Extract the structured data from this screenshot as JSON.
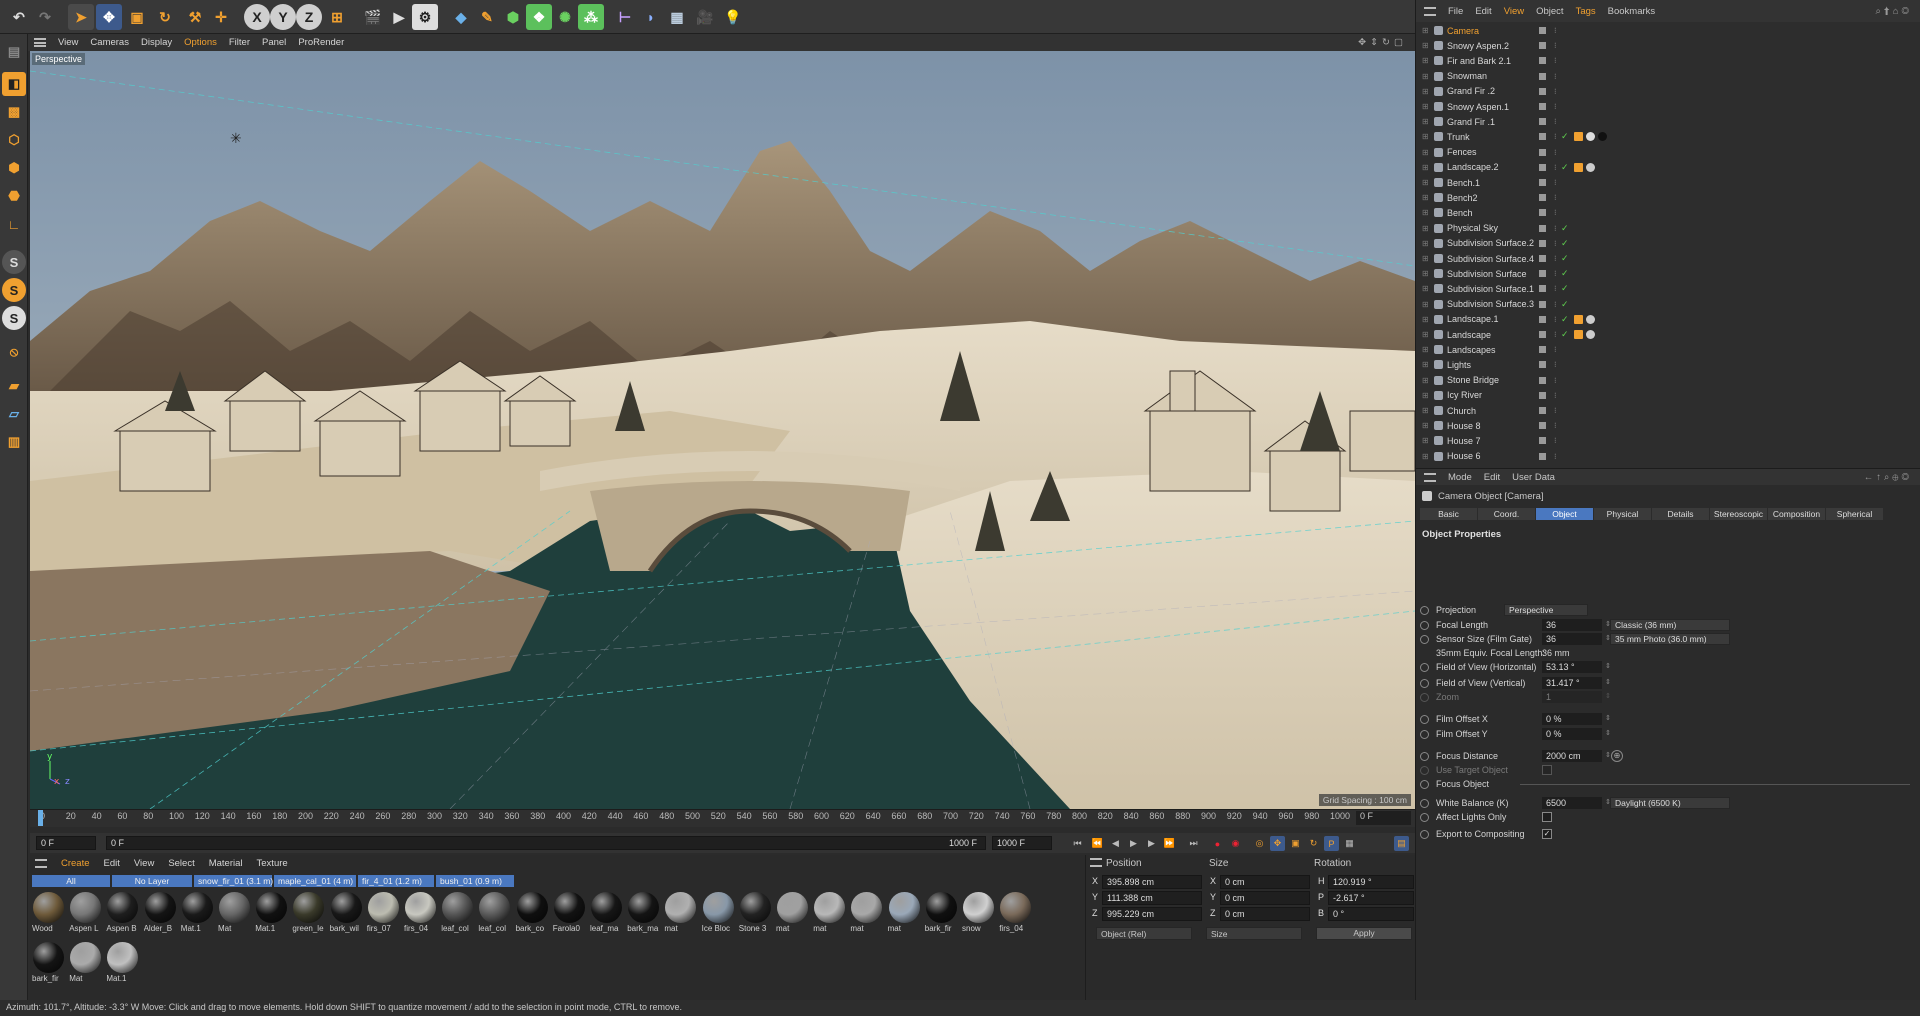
{
  "toolbar": {
    "xyz": [
      "X",
      "Y",
      "Z"
    ]
  },
  "viewport": {
    "menu": [
      "View",
      "Cameras",
      "Display",
      "Options",
      "Filter",
      "Panel",
      "ProRender"
    ],
    "label": "Perspective",
    "grid_spacing": "Grid Spacing : 100 cm"
  },
  "timeline": {
    "ticks": [
      "0",
      "20",
      "40",
      "60",
      "80",
      "100",
      "120",
      "140",
      "160",
      "180",
      "200",
      "220",
      "240",
      "260",
      "280",
      "300",
      "320",
      "340",
      "360",
      "380",
      "400",
      "420",
      "440",
      "460",
      "480",
      "500",
      "520",
      "540",
      "560",
      "580",
      "600",
      "620",
      "640",
      "660",
      "680",
      "700",
      "720",
      "740",
      "760",
      "780",
      "800",
      "820",
      "840",
      "860",
      "880",
      "900",
      "920",
      "940",
      "960",
      "980",
      "1000"
    ],
    "end_frame": "0 F"
  },
  "playbar": {
    "start": "0 F",
    "current": "0 F",
    "end": "1000 F",
    "end2": "1000 F"
  },
  "materials": {
    "menu": [
      "Create",
      "Edit",
      "View",
      "Select",
      "Material",
      "Texture"
    ],
    "layers": [
      "All",
      "No Layer",
      "snow_fir_01 (3.1 m)",
      "maple_cal_01 (4 m)",
      "fir_4_01 (1.2 m)",
      "bush_01 (0.9 m)"
    ],
    "items": [
      "Wood",
      "Aspen L",
      "Aspen B",
      "Alder_B",
      "Mat.1",
      "Mat",
      "Mat.1",
      "green_le",
      "bark_wil",
      "firs_07",
      "firs_04",
      "leaf_col",
      "leaf_col",
      "bark_co",
      "Farola0",
      "leaf_ma",
      "bark_ma",
      "mat",
      "Ice Bloc",
      "Stone 3",
      "mat",
      "mat",
      "mat",
      "mat",
      "bark_fir",
      "snow",
      "firs_04",
      "bark_fir",
      "Mat",
      "Mat.1"
    ]
  },
  "coord": {
    "headers": [
      "Position",
      "Size",
      "Rotation"
    ],
    "rows": [
      {
        "axis": "X",
        "pos": "395.898 cm",
        "size_axis": "X",
        "size": "0 cm",
        "rot_axis": "H",
        "rot": "120.919 °"
      },
      {
        "axis": "Y",
        "pos": "111.388 cm",
        "size_axis": "Y",
        "size": "0 cm",
        "rot_axis": "P",
        "rot": "-2.617 °"
      },
      {
        "axis": "Z",
        "pos": "995.229 cm",
        "size_axis": "Z",
        "size": "0 cm",
        "rot_axis": "B",
        "rot": "0 °"
      }
    ],
    "mode": "Object (Rel)",
    "size_mode": "Size",
    "apply": "Apply"
  },
  "status": "Azimuth: 101.7°, Altitude: -3.3°  W     Move: Click and drag to move elements. Hold down SHIFT to quantize movement / add to the selection in point mode, CTRL to remove.",
  "objects": {
    "menu": [
      "File",
      "Edit",
      "View",
      "Object",
      "Tags",
      "Bookmarks"
    ],
    "items": [
      "Camera",
      "Snowy Aspen.2",
      "Fir and Bark 2.1",
      "Snowman",
      "Grand Fir .2",
      "Snowy Aspen.1",
      "Grand Fir .1",
      "Trunk",
      "Fences",
      "Landscape.2",
      "Bench.1",
      "Bench2",
      "Bench",
      "Physical Sky",
      "Subdivision Surface.2",
      "Subdivision Surface.4",
      "Subdivision Surface",
      "Subdivision Surface.1",
      "Subdivision Surface.3",
      "Landscape.1",
      "Landscape",
      "Landscapes",
      "Lights",
      "Stone Bridge",
      "Icy River",
      "Church",
      "House 8",
      "House 7",
      "House 6"
    ]
  },
  "attributes": {
    "menu": [
      "Mode",
      "Edit",
      "User Data"
    ],
    "title": "Camera Object [Camera]",
    "tabs": [
      "Basic",
      "Coord.",
      "Object",
      "Physical",
      "Details",
      "Stereoscopic",
      "Composition",
      "Spherical"
    ],
    "section": "Object Properties",
    "projection_label": "Projection",
    "projection": "Perspective",
    "focal_label": "Focal Length",
    "focal": "36",
    "focal_preset": "Classic (36 mm)",
    "sensor_label": "Sensor Size (Film Gate)",
    "sensor": "36",
    "sensor_preset": "35 mm Photo (36.0 mm)",
    "equiv_label": "35mm Equiv. Focal Length:",
    "equiv": "36 mm",
    "fovh_label": "Field of View (Horizontal)",
    "fovh": "53.13 °",
    "fovv_label": "Field of View (Vertical)",
    "fovv": "31.417 °",
    "zoom_label": "Zoom",
    "zoom": "1",
    "offx_label": "Film Offset X",
    "offx": "0 %",
    "offy_label": "Film Offset Y",
    "offy": "0 %",
    "focus_label": "Focus Distance",
    "focus": "2000 cm",
    "target_label": "Use Target Object",
    "focusobj_label": "Focus Object",
    "wb_label": "White Balance (K)",
    "wb": "6500",
    "wb_preset": "Daylight (6500 K)",
    "affect_label": "Affect Lights Only",
    "export_label": "Export to Compositing"
  }
}
